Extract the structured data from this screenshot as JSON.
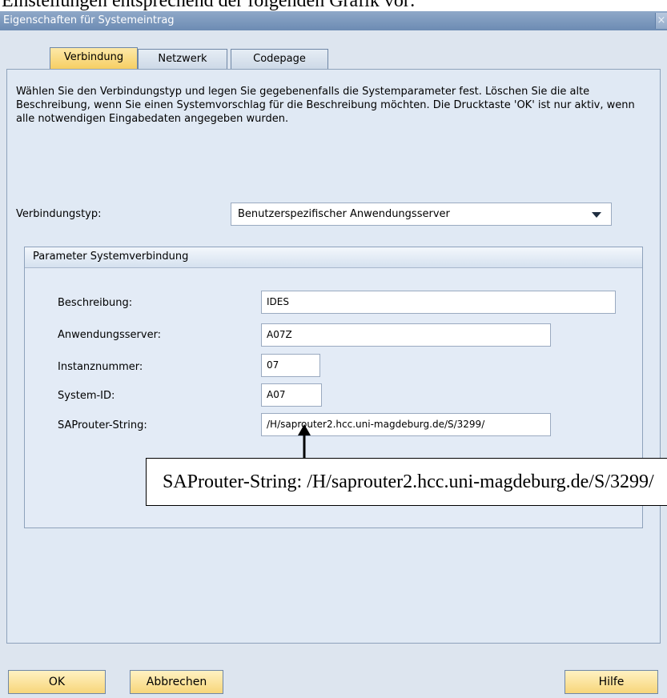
{
  "document": {
    "heading": "Einstellungen entsprechend der folgenden Grafik vor:"
  },
  "window": {
    "title": "Eigenschaften für Systemeintrag",
    "close_glyph": "×"
  },
  "tabs": [
    {
      "label": "Verbindung",
      "active": true
    },
    {
      "label": "Netzwerk",
      "active": false
    },
    {
      "label": "Codepage",
      "active": false
    }
  ],
  "instructions": "Wählen Sie den Verbindungstyp und legen Sie gegebenenfalls die Systemparameter fest. Löschen Sie die alte Beschreibung, wenn Sie einen Systemvorschlag für die Beschreibung möchten. Die Drucktaste 'OK' ist nur aktiv, wenn alle notwendigen Eingabedaten angegeben wurden.",
  "connection_type": {
    "label": "Verbindungstyp:",
    "value": "Benutzerspezifischer Anwendungsserver"
  },
  "group": {
    "title": "Parameter Systemverbindung",
    "fields": {
      "description": {
        "label": "Beschreibung:",
        "value": "IDES"
      },
      "app_server": {
        "label": "Anwendungsserver:",
        "value": "A07Z"
      },
      "instance": {
        "label": "Instanznummer:",
        "value": "07"
      },
      "system_id": {
        "label": "System-ID:",
        "value": "A07"
      },
      "saprouter": {
        "label": "SAProuter-String:",
        "value": "/H/saprouter2.hcc.uni-magdeburg.de/S/3299/"
      }
    }
  },
  "annotation": {
    "text": "SAProuter-String: /H/saprouter2.hcc.uni-magdeburg.de/S/3299/"
  },
  "buttons": {
    "ok": "OK",
    "cancel": "Abbrechen",
    "help": "Hilfe"
  },
  "colors": {
    "window_bg": "#dde5ef",
    "titlebar": "#7b97bd",
    "active_tab": "#f6cf63",
    "button": "#f7d67a"
  }
}
